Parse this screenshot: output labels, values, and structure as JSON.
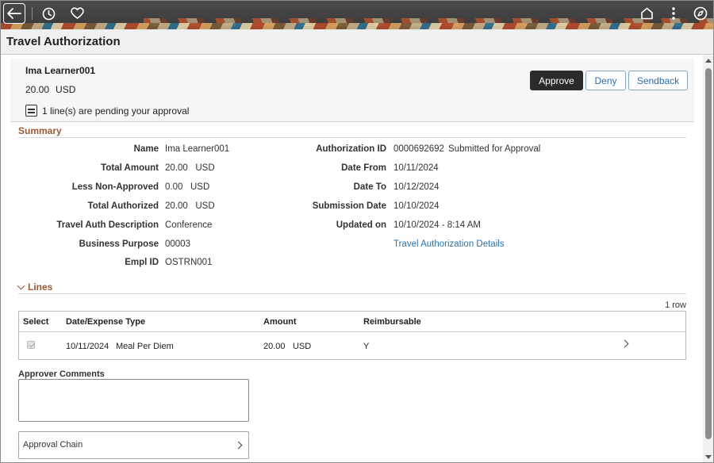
{
  "header": {
    "icons": [
      "arrow-left-icon",
      "clock-icon",
      "heart-icon",
      "home-icon",
      "more-vertical-icon",
      "compass-icon"
    ]
  },
  "page": {
    "title": "Travel Authorization"
  },
  "employee": {
    "name": "Ima Learner001",
    "amount": "20.00",
    "currency": "USD",
    "pending_text": "1 line(s) are pending your approval"
  },
  "actions": {
    "approve": "Approve",
    "deny": "Deny",
    "sendback": "Sendback"
  },
  "summary": {
    "title": "Summary",
    "left": [
      {
        "label": "Name",
        "value": "Ima Learner001"
      },
      {
        "label": "Total Amount",
        "value": "20.00   USD"
      },
      {
        "label": "Less Non-Approved",
        "value": "0.00   USD"
      },
      {
        "label": "Total Authorized",
        "value": "20.00   USD"
      },
      {
        "label": "Travel Auth Description",
        "value": "Conference"
      },
      {
        "label": "Business Purpose",
        "value": "00003"
      },
      {
        "label": "Empl ID",
        "value": "OSTRN001"
      }
    ],
    "right": [
      {
        "label": "Authorization ID",
        "value": "0000692692",
        "extra": "Submitted for Approval"
      },
      {
        "label": "Date From",
        "value": "10/11/2024"
      },
      {
        "label": "Date To",
        "value": "10/12/2024"
      },
      {
        "label": "Submission Date",
        "value": "10/10/2024"
      },
      {
        "label": "Updated on",
        "value": "10/10/2024 - 8:14 AM"
      }
    ],
    "details_link": "Travel Authorization Details"
  },
  "lines": {
    "title": "Lines",
    "row_count": "1 row",
    "columns": [
      "Select",
      "Date/Expense Type",
      "Amount",
      "Reimbursable"
    ],
    "rows": [
      {
        "date": "10/11/2024",
        "type": "Meal Per Diem",
        "amount": "20.00",
        "currency": "USD",
        "reimbursable": "Y"
      }
    ]
  },
  "comments": {
    "label": "Approver Comments",
    "value": ""
  },
  "approval_chain": {
    "label": "Approval Chain"
  },
  "colors": {
    "accent_button": "#2b2b2b",
    "link": "#2a73b0",
    "section_title": "#9c5a34",
    "banner": "#3d3d3d"
  }
}
